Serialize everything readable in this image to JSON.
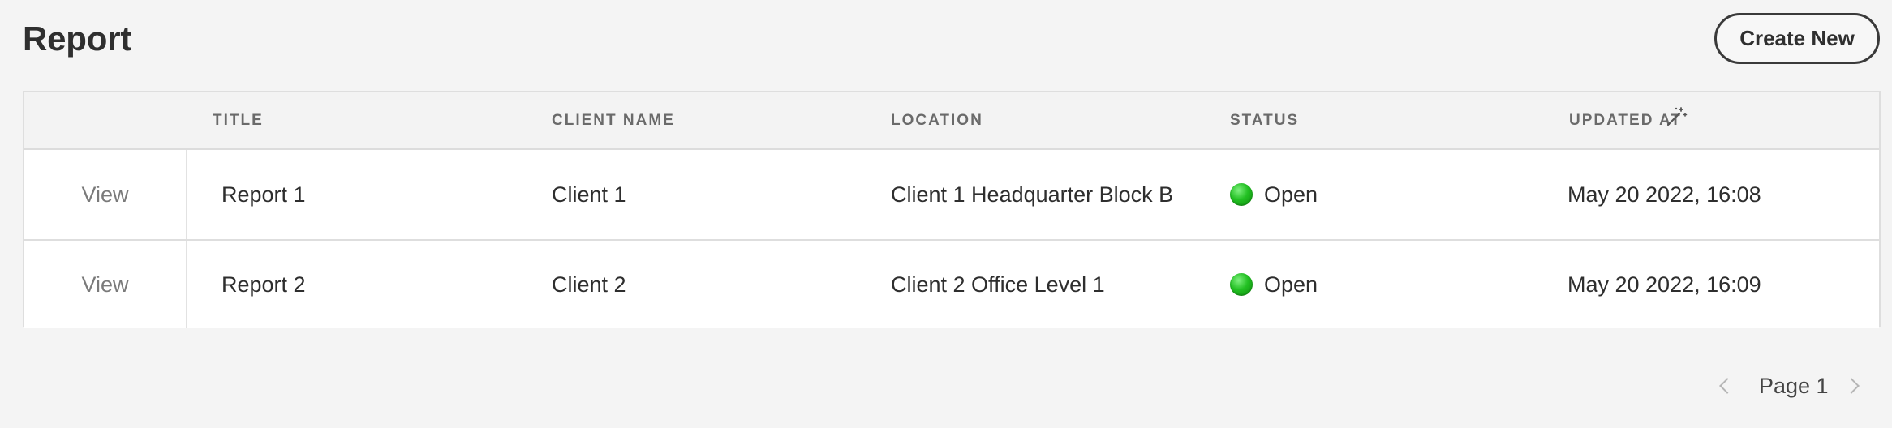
{
  "page": {
    "title": "Report",
    "create_label": "Create New"
  },
  "table": {
    "columns": [
      "TITLE",
      "CLIENT NAME",
      "LOCATION",
      "STATUS",
      "UPDATED AT"
    ],
    "rows": [
      {
        "action": "View",
        "title": "Report 1",
        "client": "Client 1",
        "location": "Client 1 Headquarter Block B",
        "status": "Open",
        "updated": "May 20 2022, 16:08"
      },
      {
        "action": "View",
        "title": "Report 2",
        "client": "Client 2",
        "location": "Client 2 Office Level 1",
        "status": "Open",
        "updated": "May 20 2022, 16:09"
      }
    ],
    "status_color": "#1fbf1f"
  },
  "pagination": {
    "label": "Page 1"
  },
  "icons": {
    "sort_tool": "magic-wand-icon",
    "prev": "chevron-left-icon",
    "next": "chevron-right-icon",
    "status": "status-dot-icon"
  }
}
